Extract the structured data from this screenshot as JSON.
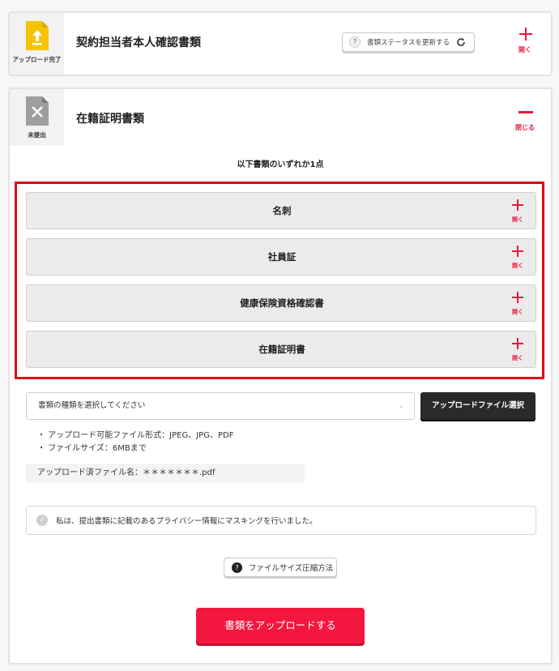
{
  "cards": [
    {
      "status_label": "アップロード完了",
      "title": "契約担当者本人確認書類",
      "status_button_icon": "question-mark",
      "status_button_label": "書類ステータスを更新する",
      "toggle_label": "開く",
      "icon": "upload-document-icon",
      "icon_color": "#f5c400"
    },
    {
      "status_label": "未提出",
      "title": "在籍証明書類",
      "toggle_label": "閉じる",
      "icon": "not-submitted-document-icon",
      "icon_color": "#9e9e9e",
      "instruction": "以下書類のいずれか1点",
      "options": [
        {
          "label": "名刺",
          "open_label": "開く"
        },
        {
          "label": "社員証",
          "open_label": "開く"
        },
        {
          "label": "健康保険資格確認書",
          "open_label": "開く"
        },
        {
          "label": "在籍証明書",
          "open_label": "開く"
        }
      ],
      "select_placeholder": "書類の種類を選択してください",
      "file_select_label": "アップロードファイル選択",
      "notes": [
        "アップロード可能ファイル形式：JPEG、JPG、PDF",
        "ファイルサイズ：6MBまで"
      ],
      "uploaded_file": "アップロード済ファイル名：＊＊＊＊＊＊＊.pdf",
      "consent_text": "私は、提出書類に記載のあるプライバシー情報にマスキングを行いました。",
      "compress_label": "ファイルサイズ圧縮方法",
      "upload_label": "書類をアップロードする"
    }
  ],
  "colors": {
    "accent_red": "#e8173a",
    "highlight_frame": "#e60012",
    "upload_button": "#f3173f",
    "dark_button": "#2a2a2a"
  }
}
